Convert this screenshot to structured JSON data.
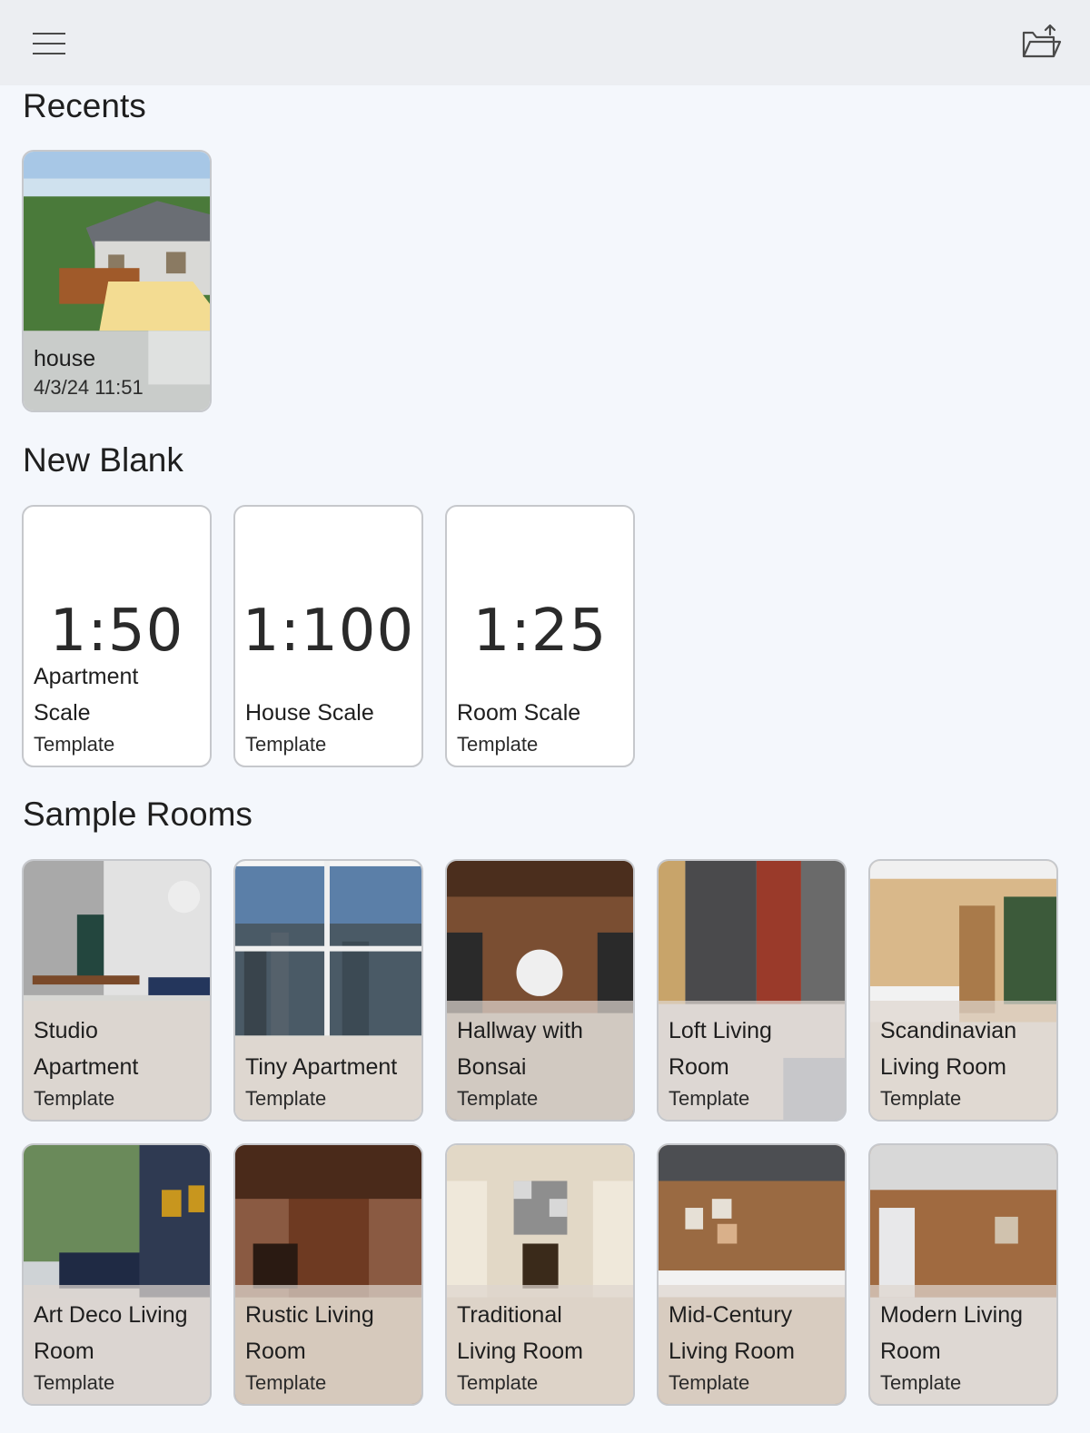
{
  "toolbar": {
    "menu_icon": "hamburger-menu-icon",
    "open_icon": "folder-open-icon"
  },
  "sections": {
    "recents": "Recents",
    "new_blank": "New Blank",
    "sample_rooms": "Sample Rooms"
  },
  "recents": [
    {
      "title": "house",
      "date": "4/3/24 11:51"
    }
  ],
  "blanks": [
    {
      "scale": "1:50",
      "title_line1": "Apartment",
      "title_line2": "Scale",
      "sub": "Template"
    },
    {
      "scale": "1:100",
      "title": "House Scale",
      "sub": "Template"
    },
    {
      "scale": "1:25",
      "title": "Room Scale",
      "sub": "Template"
    }
  ],
  "samples": [
    {
      "line1": "Studio",
      "line2": "Apartment",
      "sub": "Template"
    },
    {
      "line1": "Tiny Apartment",
      "sub": "Template"
    },
    {
      "line1": "Hallway with",
      "line2": "Bonsai",
      "sub": "Template"
    },
    {
      "line1": "Loft Living",
      "line2": "Room",
      "sub": "Template"
    },
    {
      "line1": "Scandinavian",
      "line2": "Living Room",
      "sub": "Template"
    },
    {
      "line1": "Art Deco Living",
      "line2": "Room",
      "sub": "Template"
    },
    {
      "line1": "Rustic Living",
      "line2": "Room",
      "sub": "Template"
    },
    {
      "line1": "Traditional",
      "line2": "Living Room",
      "sub": "Template"
    },
    {
      "line1": "Mid-Century",
      "line2": "Living Room",
      "sub": "Template"
    },
    {
      "line1": "Modern Living",
      "line2": "Room",
      "sub": "Template"
    }
  ]
}
